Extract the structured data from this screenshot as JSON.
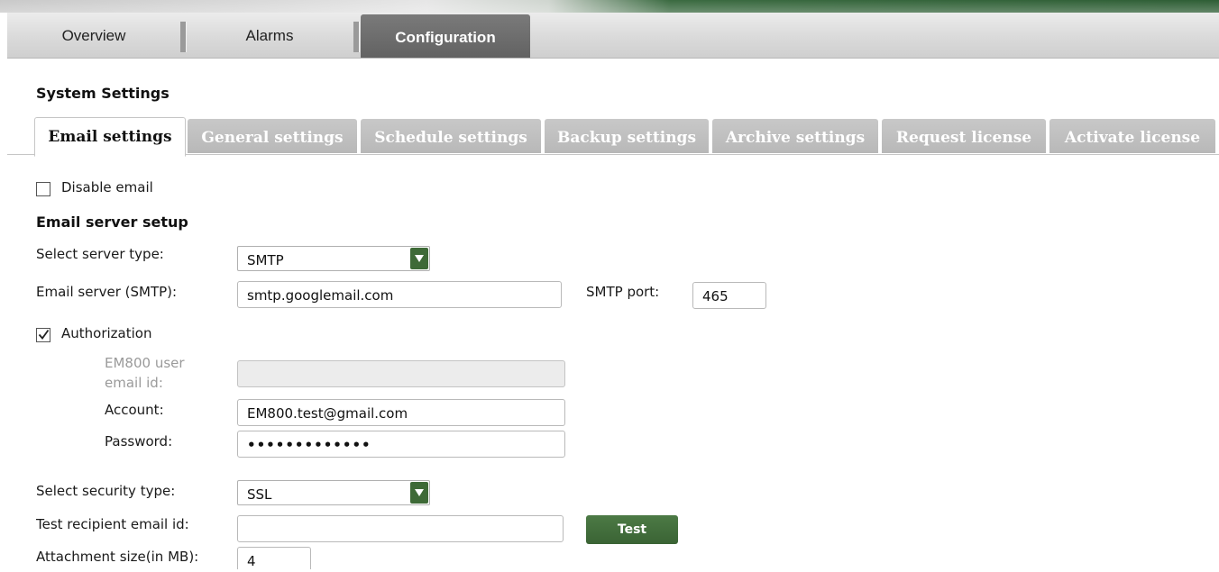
{
  "main_nav": {
    "tabs": [
      {
        "label": "Overview",
        "active": false
      },
      {
        "label": "Alarms",
        "active": false
      },
      {
        "label": "Configuration",
        "active": true
      }
    ]
  },
  "section_title": "System Settings",
  "sub_tabs": [
    {
      "label": "Email settings",
      "active": true
    },
    {
      "label": "General settings",
      "active": false
    },
    {
      "label": "Schedule settings",
      "active": false
    },
    {
      "label": "Backup settings",
      "active": false
    },
    {
      "label": "Archive settings",
      "active": false
    },
    {
      "label": "Request license",
      "active": false
    },
    {
      "label": "Activate license",
      "active": false
    }
  ],
  "form": {
    "disable_email": {
      "label": "Disable email",
      "checked": false
    },
    "server_setup_heading": "Email server setup",
    "server_type": {
      "label": "Select server type:",
      "value": "SMTP"
    },
    "email_server": {
      "label": "Email server (SMTP):",
      "value": "smtp.googlemail.com"
    },
    "smtp_port": {
      "label": "SMTP port:",
      "value": "465"
    },
    "authorization": {
      "label": "Authorization",
      "checked": true
    },
    "user_email_id": {
      "label_line1": "EM800 user",
      "label_line2": "email id:",
      "value": ""
    },
    "account": {
      "label": "Account:",
      "value": "EM800.test@gmail.com"
    },
    "password": {
      "label": "Password:",
      "value": "•••••••••••••"
    },
    "security_type": {
      "label": "Select security type:",
      "value": "SSL"
    },
    "test_recipient": {
      "label": "Test recipient email id:",
      "value": ""
    },
    "test_button": {
      "label": "Test"
    },
    "attachment_size": {
      "label": "Attachment size(in MB):",
      "value": "4"
    }
  },
  "colors": {
    "accent_green": "#3e6a37",
    "active_nav_tab": "#666666",
    "inactive_sub_tab": "#bdbdbd"
  }
}
